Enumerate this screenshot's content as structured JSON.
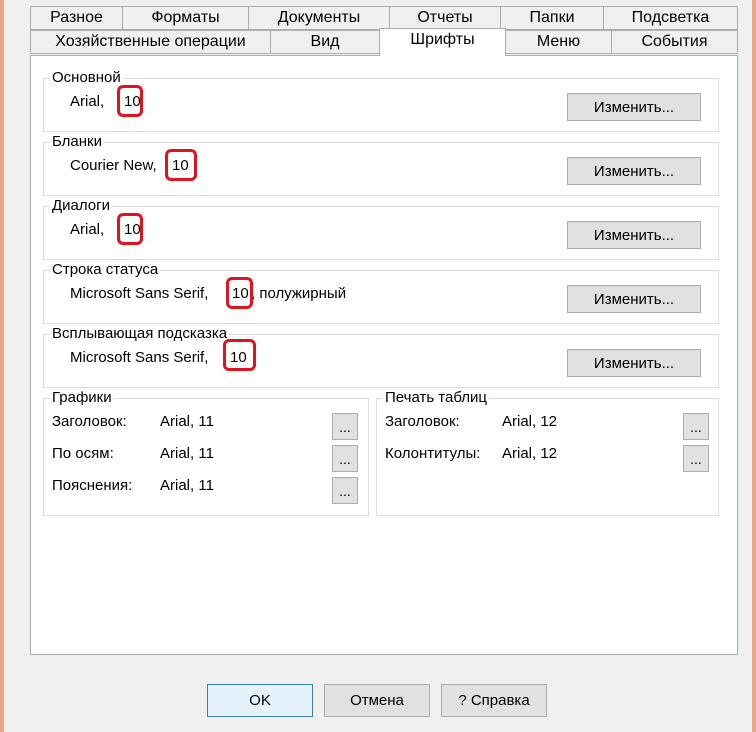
{
  "tabs_row1": [
    "Разное",
    "Форматы",
    "Документы",
    "Отчеты",
    "Папки",
    "Подсветка"
  ],
  "tabs_row2": [
    "Хозяйственные операции",
    "Вид",
    "Шрифты",
    "Меню",
    "События"
  ],
  "active_tab": "Шрифты",
  "fonts": {
    "main": {
      "title": "Основной",
      "name": "Arial,",
      "size": "10"
    },
    "forms": {
      "title": "Бланки",
      "name": "Courier New,",
      "size": "10"
    },
    "dialogs": {
      "title": "Диалоги",
      "name": "Arial,",
      "size": "10"
    },
    "statusbar": {
      "title": "Строка статуса",
      "name": "Microsoft Sans Serif,",
      "size": "10",
      "suffix": ", полужирный"
    },
    "tooltip": {
      "title": "Всплывающая подсказка",
      "name": "Microsoft Sans Serif,",
      "size": "10"
    }
  },
  "change_label": "Изменить...",
  "charts": {
    "title": "Графики",
    "rows": [
      {
        "label": "Заголовок:",
        "value": "Arial, 11"
      },
      {
        "label": "По осям:",
        "value": "Arial, 11"
      },
      {
        "label": "Пояснения:",
        "value": "Arial, 11"
      }
    ]
  },
  "print_tables": {
    "title": "Печать таблиц",
    "rows": [
      {
        "label": "Заголовок:",
        "value": "Arial, 12"
      },
      {
        "label": "Колонтитулы:",
        "value": "Arial, 12"
      }
    ]
  },
  "ellipsis": "...",
  "buttons": {
    "ok": "OK",
    "cancel": "Отмена",
    "help": "? Справка"
  },
  "colors": {
    "highlight": "#e0141e",
    "frame": "#e8a88a"
  }
}
